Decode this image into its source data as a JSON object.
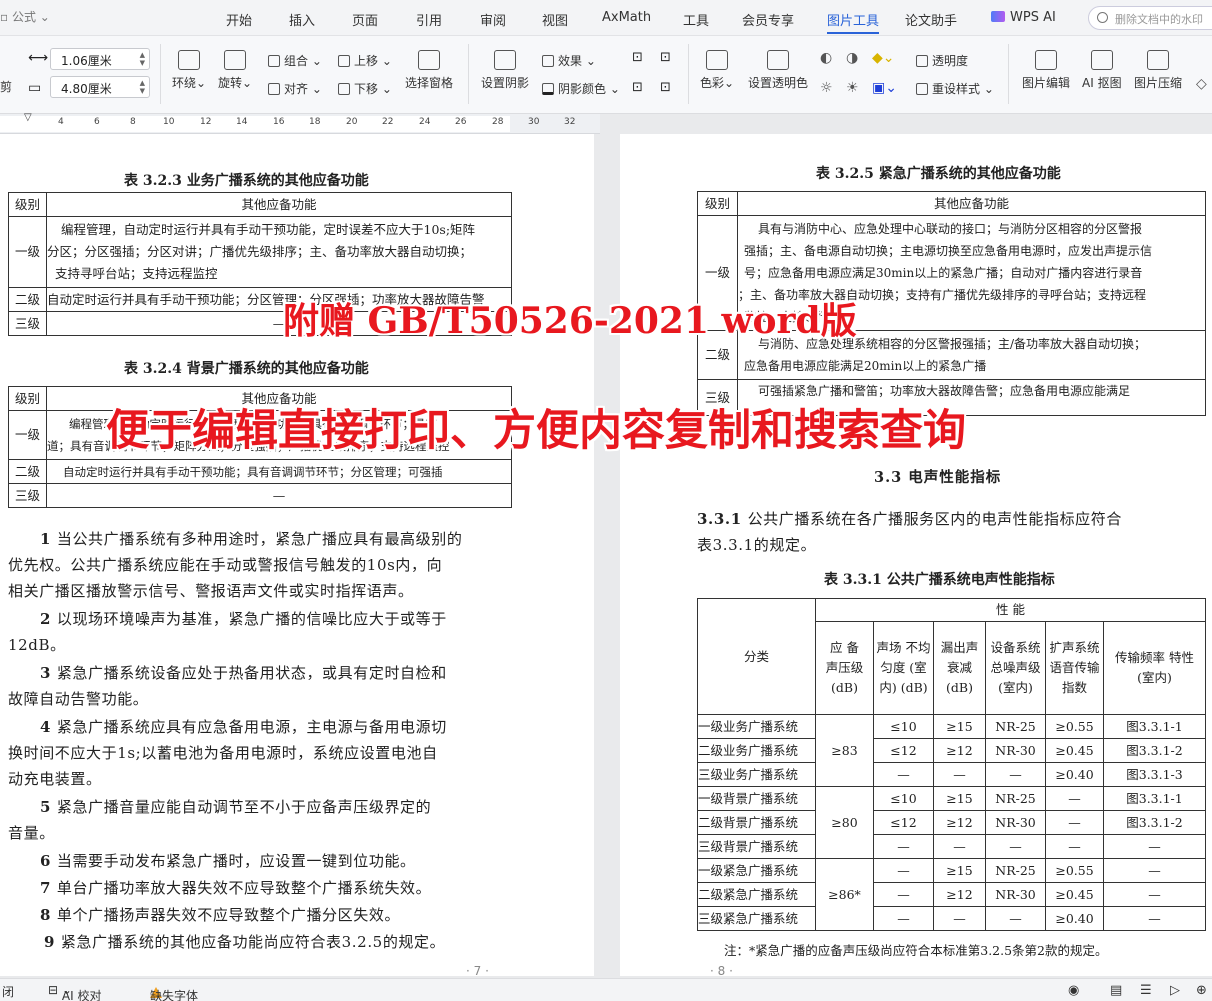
{
  "menu": {
    "formula": "公式",
    "tabs": [
      "开始",
      "插入",
      "页面",
      "引用",
      "审阅",
      "视图",
      "AxMath",
      "工具",
      "会员专享",
      "图片工具",
      "论文助手",
      "WPS AI"
    ],
    "search_placeholder": "删除文档中的水印"
  },
  "toolbar": {
    "crop": "剪",
    "width": "1.06厘米",
    "height": "4.80厘米",
    "wrap": "环绕",
    "rotate": "旋转",
    "group": "组合",
    "align": "对齐",
    "bring_forward": "上移",
    "send_backward": "下移",
    "selection_pane": "选择窗格",
    "shadow": "设置阴影",
    "effect": "效果",
    "shadow_color": "阴影颜色",
    "color": "色彩",
    "set_transparent_color": "设置透明色",
    "transparency": "透明度",
    "reset_style": "重设样式",
    "image_edit": "图片编辑",
    "ai_cutout": "AI 抠图",
    "compress": "图片压缩"
  },
  "ruler": [
    "4",
    "6",
    "8",
    "10",
    "12",
    "14",
    "16",
    "18",
    "20",
    "22",
    "24",
    "26",
    "28",
    "30",
    "32"
  ],
  "left": {
    "t1_caption": "表 3.2.3  业务广播系统的其他应备功能",
    "t1": {
      "h1": "级别",
      "h2": "其他应备功能",
      "r1l": "一级",
      "r1a": "编程管理，自动定时运行并具有手动干预功能，定时误差不应大于10s;矩阵",
      "r1b": "分区；分区强插；分区对讲；广播优先级排序；主、备功率放大器自动切换；",
      "r1c": "支持寻呼台站；支持远程监控",
      "r2l": "二级",
      "r2": "自动定时运行并具有手动干预功能；分区管理；分区强插；功率放大器故障告警",
      "r3l": "三级",
      "r3": "—"
    },
    "t2_caption": "表 3.2.4  背景广播系统的其他应备功能",
    "t2": {
      "h1": "级别",
      "h2": "其他应备功能",
      "r1l": "一级",
      "r1a": "编程管理，自动定时运行并具有手动干预功能；具有音调调节环节；具有",
      "r1b": "道；具有音调调节环节；矩阵分区；分区强插；广播优先级排序；支持远程监控",
      "r2l": "二级",
      "r2": "自动定时运行并具有手动干预功能；具有音调调节环节；分区管理；可强插",
      "r3l": "三级",
      "r3": "—"
    },
    "p1a": "1 ",
    "p1b": "当公共广播系统有多种用途时，紧急广播应具有最高级别的",
    "p1c": "优先权。公共广播系统应能在手动或警报信号触发的10s内，向",
    "p1d": "相关广播区播放警示信号、警报语声文件或实时指挥语声。",
    "p2a": "2 ",
    "p2b": "以现场环境噪声为基准，紧急广播的信噪比应大于或等于",
    "p2c": "12dB。",
    "p3a": "3 ",
    "p3b": "紧急广播系统设备应处于热备用状态，或具有定时自检和",
    "p3c": "故障自动告警功能。",
    "p4a": "4 ",
    "p4b": "紧急广播系统应具有应急备用电源，主电源与备用电源切",
    "p4c": "换时间不应大于1s;以蓄电池为备用电源时，系统应设置电池自",
    "p4d": "动充电装置。",
    "p5a": "5 ",
    "p5b": "紧急广播音量应能自动调节至不小于应备声压级界定的",
    "p5c": "音量。",
    "p6a": "6 ",
    "p6b": "当需要手动发布紧急广播时，应设置一键到位功能。",
    "p7a": "7 ",
    "p7b": "单台广播功率放大器失效不应导致整个广播系统失效。",
    "p8a": "8 ",
    "p8b": "单个广播扬声器失效不应导致整个广播分区失效。",
    "p9a": "9 ",
    "p9b": "紧急广播系统的其他应备功能尚应符合表3.2.5的规定。",
    "page_num": "· 7 ·"
  },
  "right": {
    "t3_caption": "表 3.2.5  紧急广播系统的其他应备功能",
    "t3": {
      "h1": "级别",
      "h2": "其他应备功能",
      "r1l": "一级",
      "r1a": "具有与消防中心、应急处理中心联动的接口；与消防分区相容的分区警报",
      "r1b": "强插；主、备电源自动切换；主电源切换至应急备用电源时，应发出声提示信",
      "r1c": "号；应急备用电源应满足30min以上的紧急广播；自动对广播内容进行录音",
      "r1d": "；主、备功率放大器自动切换；支持有广播优先级排序的寻呼台站；支持远程",
      "r1e": "监控；支持运行记录",
      "r2l": "二级",
      "r2a": "与消防、应急处理系统相容的分区警报强插；主/备功率放大器自动切换；",
      "r2b": "应急备用电源应能满足20min以上的紧急广播",
      "r3l": "三级",
      "r3": "可强插紧急广播和警笛；功率放大器故障告警；应急备用电源应能满足"
    },
    "section": "3.3  电声性能指标",
    "p331a": "3.3.1 ",
    "p331b": "公共广播系统在各广播服务区内的电声性能指标应符合",
    "p331c": "表3.3.1的规定。",
    "t4_caption": "表 3.3.1  公共广播系统电声性能指标",
    "t4": {
      "cls": "分类",
      "perf": "性    能",
      "c1": "应 备 声压级 (dB)",
      "c2": "声场 不均匀度 (室内) (dB)",
      "c3": "漏出声 衰减 (dB)",
      "c4": "设备系统 总噪声级 (室内)",
      "c5": "扩声系统 语音传输 指数",
      "c6": "传输频率 特性 (室内)",
      "rows": [
        [
          "一级业务广播系统",
          "≤10",
          "≥15",
          "NR-25",
          "≥0.55",
          "图3.3.1-1"
        ],
        [
          "二级业务广播系统",
          "≤12",
          "≥12",
          "NR-30",
          "≥0.45",
          "图3.3.1-2"
        ],
        [
          "三级业务广播系统",
          "—",
          "—",
          "—",
          "≥0.40",
          "图3.3.1-3"
        ],
        [
          "一级背景广播系统",
          "≤10",
          "≥15",
          "NR-25",
          "—",
          "图3.3.1-1"
        ],
        [
          "二级背景广播系统",
          "≤12",
          "≥12",
          "NR-30",
          "—",
          "图3.3.1-2"
        ],
        [
          "三级背景广播系统",
          "—",
          "—",
          "—",
          "—",
          "—"
        ],
        [
          "一级紧急广播系统",
          "—",
          "≥15",
          "NR-25",
          "≥0.55",
          "—"
        ],
        [
          "二级紧急广播系统",
          "—",
          "≥12",
          "NR-30",
          "≥0.45",
          "—"
        ],
        [
          "三级紧急广播系统",
          "—",
          "—",
          "—",
          "≥0.40",
          "—"
        ]
      ],
      "spl": [
        "≥83",
        "≥80",
        "≥86*"
      ]
    },
    "note": "注：*紧急广播的应备声压级尚应符合本标准第3.2.5条第2款的规定。",
    "page_num": "· 8 ·"
  },
  "watermark": {
    "line1": "附赠 GB/T50526-2021 word版",
    "line2": "便于编辑直接打印、方便内容复制和搜索查询"
  },
  "status": {
    "left": "闭",
    "ai": "AI 校对",
    "missing_font": "缺失字体"
  }
}
